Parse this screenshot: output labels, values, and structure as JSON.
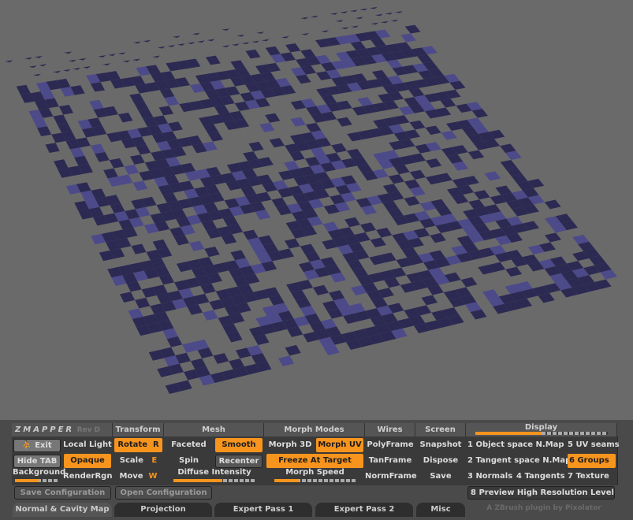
{
  "header": {
    "logo": "ZMAPPER",
    "rev": "Rev D",
    "transform": "Transform",
    "mesh": "Mesh",
    "morph_modes": "Morph Modes",
    "wires": "Wires",
    "screen": "Screen",
    "display": "Display"
  },
  "zmapper": {
    "exit": "Exit",
    "local_light": "Local Light",
    "hide_tab": "Hide TAB",
    "opaque": "Opaque",
    "background": "Background",
    "render_rgn": "RenderRgn",
    "background_level": 0.55
  },
  "transform": {
    "rotate": "Rotate",
    "rotate_key": "R",
    "scale": "Scale",
    "scale_key": "E",
    "move": "Move",
    "move_key": "W"
  },
  "mesh": {
    "faceted": "Faceted",
    "smooth": "Smooth",
    "spin": "Spin",
    "recenter": "Recenter",
    "diffuse": "Diffuse Intensity",
    "diffuse_level": 0.6
  },
  "morph": {
    "morph3d": "Morph 3D",
    "morphuv": "Morph UV",
    "freeze": "Freeze At Target",
    "speed": "Morph Speed",
    "speed_level": 0.3
  },
  "wires": {
    "poly": "PolyFrame",
    "tan": "TanFrame",
    "norm": "NormFrame"
  },
  "screen": {
    "snapshot": "Snapshot",
    "dispose": "Dispose",
    "save": "Save"
  },
  "display": {
    "level": 0.5,
    "items": [
      "1 Object space N.Map",
      "5 UV seams",
      "2 Tangent space N.Map",
      "6 Groups",
      "3 Normals",
      "4 Tangents",
      "7 Texture",
      "8 Preview High Resolution Level"
    ]
  },
  "config": {
    "save": "Save Configuration",
    "open": "Open Configuration"
  },
  "tabs": [
    "Normal & Cavity Map",
    "Projection",
    "Expert Pass 1",
    "Expert Pass 2",
    "Misc"
  ],
  "credit": "A ZBrush plugin by Pixolator",
  "colors": {
    "accent": "#f7941d",
    "mesh": "#2c2a52",
    "background": "#6a6a6a"
  }
}
